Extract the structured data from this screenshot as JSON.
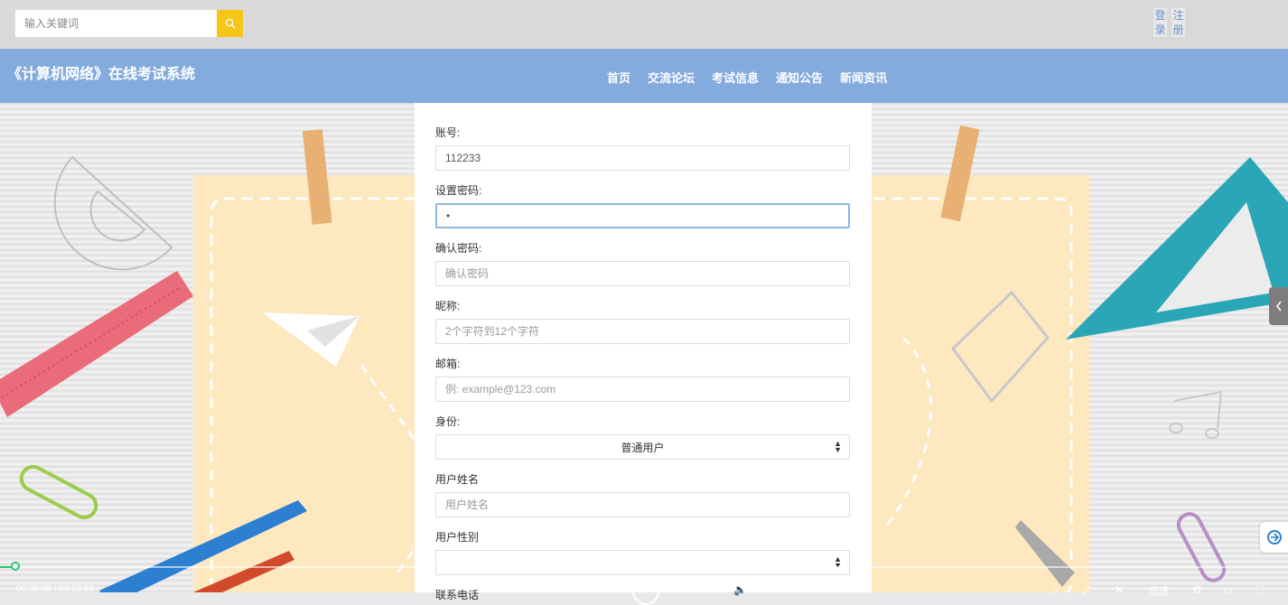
{
  "search": {
    "placeholder": "输入关键词",
    "icon": "search-icon"
  },
  "auth": {
    "login": "登\n录",
    "register": "注\n册"
  },
  "site": {
    "title": "《计算机网络》在线考试系统"
  },
  "nav": [
    "首页",
    "交流论坛",
    "考试信息",
    "通知公告",
    "新闻资讯"
  ],
  "form": {
    "account": {
      "label": "账号:",
      "value": "112233"
    },
    "password": {
      "label": "设置密码:",
      "value": "•"
    },
    "confirm": {
      "label": "确认密码:",
      "placeholder": "确认密码"
    },
    "nickname": {
      "label": "昵称:",
      "placeholder": "2个字符到12个字符"
    },
    "email": {
      "label": "邮箱:",
      "placeholder": "例: example@123.com"
    },
    "identity": {
      "label": "身份:",
      "value": "普通用户"
    },
    "realname": {
      "label": "用户姓名",
      "placeholder": "用户姓名"
    },
    "gender": {
      "label": "用户性别",
      "value": ""
    },
    "phone": {
      "label": "联系电话"
    }
  },
  "player": {
    "time": "00:00:08 / 00:09:59",
    "speed": "倍速",
    "progress": 0.013
  },
  "colors": {
    "navbar": "#84abde",
    "topbar": "#d9d9d9",
    "search_button": "#f5c518",
    "progress": "#2ec46b"
  }
}
